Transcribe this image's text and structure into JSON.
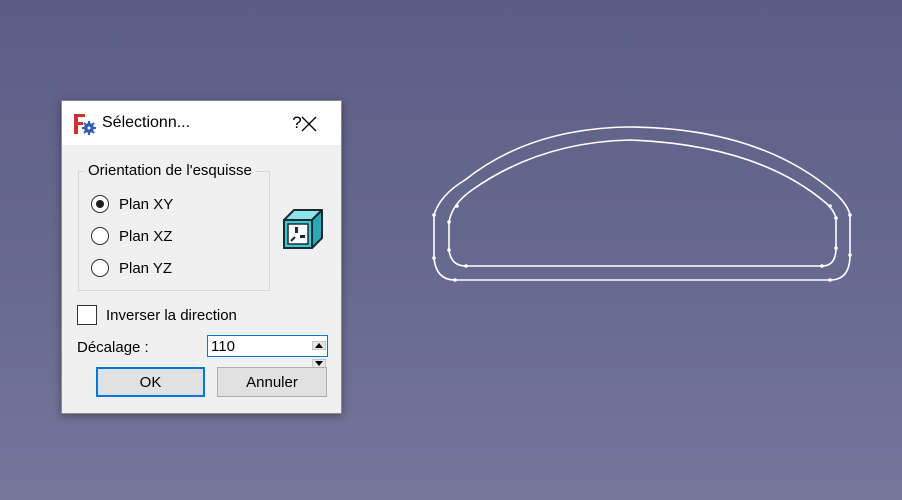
{
  "dialog": {
    "title": "Sélectionn...",
    "help_label": "?",
    "app_icon": "freecad-gear-icon",
    "close_icon": "close-icon"
  },
  "orientation": {
    "group_title": "Orientation de l'esquisse",
    "options": [
      {
        "label": "Plan XY",
        "selected": true
      },
      {
        "label": "Plan XZ",
        "selected": false
      },
      {
        "label": "Plan YZ",
        "selected": false
      }
    ],
    "preview_icon": "view-cube-icon"
  },
  "invert": {
    "label": "Inverser la direction",
    "checked": false
  },
  "offset": {
    "label": "Décalage :",
    "value": "110"
  },
  "buttons": {
    "ok": "OK",
    "cancel": "Annuler"
  },
  "colors": {
    "accent": "#0078d7",
    "viewport_top": "#5b5d86",
    "viewport_bottom": "#74769a",
    "sketch_line": "#ffffff",
    "cube_teal": "#3ec9d6"
  }
}
